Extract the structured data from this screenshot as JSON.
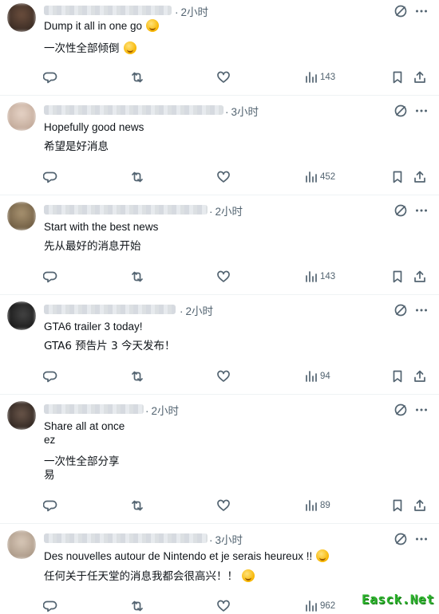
{
  "posts": [
    {
      "time": "2小时",
      "text_en": "Dump it all in one go",
      "text_zh": "一次性全部倾倒",
      "views": "143",
      "avatar_color": "#6b4e3d"
    },
    {
      "time": "3小时",
      "text_en": "Hopefully good news",
      "text_zh": "希望是好消息",
      "views": "452",
      "avatar_color": "#d9c1b2"
    },
    {
      "time": "2小时",
      "text_en": "Start with the best news",
      "text_zh": "先从最好的消息开始",
      "views": "143",
      "avatar_color": "#8c7a5c"
    },
    {
      "time": "2小时",
      "text_en": "GTA6 trailer 3 today!",
      "text_zh": "GTA6 预告片 3 今天发布！",
      "views": "94",
      "avatar_color": "#222222"
    },
    {
      "time": "2小时",
      "text_en": "Share all at once\nez",
      "text_zh": "一次性全部分享\n易",
      "views": "89",
      "avatar_color": "#3a2f2a"
    },
    {
      "time": "3小时",
      "text_en": "Des nouvelles autour de Nintendo et je serais heureux !!",
      "text_zh": "任何关于任天堂的消息我都会很高兴！！",
      "views": "962",
      "avatar_color": "#c9b8a6"
    }
  ],
  "watermark": "Easck.Net"
}
